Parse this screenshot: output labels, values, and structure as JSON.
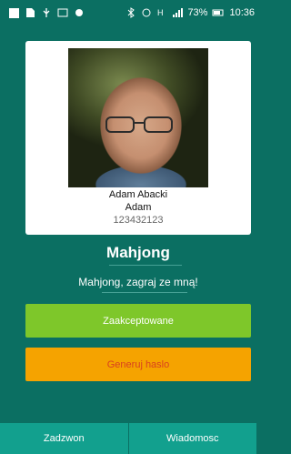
{
  "status_bar": {
    "battery_percent": "73%",
    "time": "10:36",
    "icons": [
      "notification-square-icon",
      "sim-icon",
      "usb-icon",
      "image-icon",
      "android-icon",
      "bluetooth-icon",
      "alarm-icon",
      "h-signal-icon",
      "signal-icon",
      "battery-icon"
    ]
  },
  "contact": {
    "full_name": "Adam Abacki",
    "first_name": "Adam",
    "phone": "123432123"
  },
  "game": {
    "title": "Mahjong",
    "subtitle": "Mahjong, zagraj ze mną!"
  },
  "buttons": {
    "accept": "Zaakceptowane",
    "generate": "Generuj haslo"
  },
  "bottom_bar": {
    "call": "Zadzwon",
    "message": "Wiadomosc"
  },
  "colors": {
    "background": "#0b6f62",
    "accept": "#7ec72a",
    "generate": "#f5a300",
    "generate_text": "#d9411e",
    "bottom_bar": "#12a08e"
  }
}
